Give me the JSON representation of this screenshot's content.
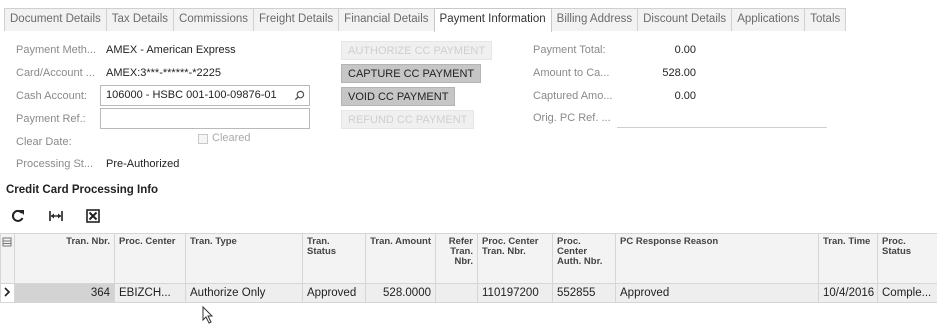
{
  "tabs": [
    {
      "label": "Document Details",
      "active": false
    },
    {
      "label": "Tax Details",
      "active": false
    },
    {
      "label": "Commissions",
      "active": false
    },
    {
      "label": "Freight Details",
      "active": false
    },
    {
      "label": "Financial Details",
      "active": false
    },
    {
      "label": "Payment Information",
      "active": true
    },
    {
      "label": "Billing Address",
      "active": false
    },
    {
      "label": "Discount Details",
      "active": false
    },
    {
      "label": "Applications",
      "active": false
    },
    {
      "label": "Totals",
      "active": false
    }
  ],
  "form": {
    "payment_method_label": "Payment Meth...",
    "payment_method_value": "AMEX - American Express",
    "card_account_label": "Card/Account ...",
    "card_account_value": "AMEX:3***-******-*2225",
    "cash_account_label": "Cash Account:",
    "cash_account_value": "106000 - HSBC 001-100-09876-01",
    "payment_ref_label": "Payment Ref.:",
    "payment_ref_value": "",
    "clear_date_label": "Clear Date:",
    "cleared_label": "Cleared",
    "processing_status_label": "Processing St...",
    "processing_status_value": "Pre-Authorized"
  },
  "buttons": {
    "authorize": "AUTHORIZE CC PAYMENT",
    "capture": "CAPTURE CC PAYMENT",
    "void": "VOID CC PAYMENT",
    "refund": "REFUND CC PAYMENT"
  },
  "totals": {
    "payment_total_label": "Payment Total:",
    "payment_total_value": "0.00",
    "amount_to_capture_label": "Amount to Ca...",
    "amount_to_capture_value": "528.00",
    "captured_amount_label": "Captured Amo...",
    "captured_amount_value": "0.00",
    "orig_pc_ref_label": "Orig. PC Ref. ..."
  },
  "section": {
    "title": "Credit Card Processing Info"
  },
  "toolbar": {
    "icons": [
      "refresh-icon",
      "fit-columns-icon",
      "export-excel-icon"
    ]
  },
  "grid": {
    "columns": [
      "Tran. Nbr.",
      "Proc. Center",
      "Tran. Type",
      "Tran. Status",
      "Tran. Amount",
      "Refer Tran. Nbr.",
      "Proc. Center Tran. Nbr.",
      "Proc. Center Auth. Nbr.",
      "PC Response Reason",
      "Tran. Time",
      "Proc. Status"
    ],
    "rows": [
      [
        "364",
        "EBIZCH...",
        "Authorize Only",
        "Approved",
        "528.0000",
        "",
        "110197200",
        "552855",
        "Approved",
        "10/4/2016",
        "Comple..."
      ]
    ]
  }
}
